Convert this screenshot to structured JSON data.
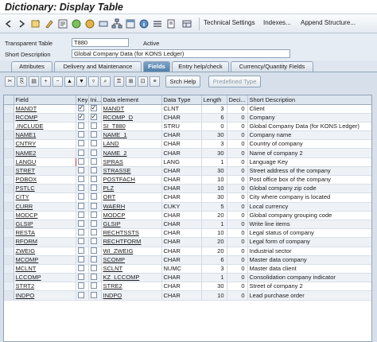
{
  "title": "Dictionary: Display Table",
  "toolbar": {
    "technical_settings": "Technical Settings",
    "indexes": "Indexes...",
    "append_structure": "Append Structure..."
  },
  "header": {
    "table_type_label": "Transparent Table",
    "table_name": "T880",
    "status": "Active",
    "short_desc_label": "Short Description",
    "short_desc": "Global Company Data (for KONS Ledger)"
  },
  "tabs": [
    {
      "label": "Attributes"
    },
    {
      "label": "Delivery and Maintenance"
    },
    {
      "label": "Fields"
    },
    {
      "label": "Entry help/check"
    },
    {
      "label": "Currency/Quantity Fields"
    }
  ],
  "field_toolbar": {
    "srch_help": "Srch Help",
    "predefined_type": "Predefined Type"
  },
  "columns": [
    "Field",
    "Key",
    "Ini...",
    "Data element",
    "Data Type",
    "Length",
    "Deci...",
    "Short Description"
  ],
  "rows": [
    {
      "field": "MANDT",
      "key": true,
      "ini": true,
      "elem": "MANDT",
      "type": "CLNT",
      "len": "3",
      "dec": "0",
      "desc": "Client"
    },
    {
      "field": "RCOMP",
      "key": true,
      "ini": true,
      "elem": "RCOMP_D",
      "type": "CHAR",
      "len": "6",
      "dec": "0",
      "desc": "Company"
    },
    {
      "field": ".INCLUDE",
      "key": false,
      "ini": false,
      "elem": "SI_T880",
      "type": "STRU",
      "len": "0",
      "dec": "0",
      "desc": "Global Company Data (for KONS Ledger)"
    },
    {
      "field": "NAME1",
      "key": false,
      "ini": false,
      "elem": "NAME_1",
      "type": "CHAR",
      "len": "30",
      "dec": "0",
      "desc": "Company name"
    },
    {
      "field": "CNTRY",
      "key": false,
      "ini": false,
      "elem": "LAND",
      "type": "CHAR",
      "len": "3",
      "dec": "0",
      "desc": "Country of company"
    },
    {
      "field": "NAME2",
      "key": false,
      "ini": false,
      "elem": "NAME_2",
      "type": "CHAR",
      "len": "30",
      "dec": "0",
      "desc": "Name of company 2"
    },
    {
      "field": "LANGU",
      "key": false,
      "ini": false,
      "elem": "SPRAS",
      "type": "LANG",
      "len": "1",
      "dec": "0",
      "desc": "Language Key"
    },
    {
      "field": "STRET",
      "key": false,
      "ini": false,
      "elem": "STRASSE",
      "type": "CHAR",
      "len": "30",
      "dec": "0",
      "desc": "Street address of the company"
    },
    {
      "field": "POBOX",
      "key": false,
      "ini": false,
      "elem": "POSTFACH",
      "type": "CHAR",
      "len": "10",
      "dec": "0",
      "desc": "Post office box of the company"
    },
    {
      "field": "PSTLC",
      "key": false,
      "ini": false,
      "elem": "PLZ",
      "type": "CHAR",
      "len": "10",
      "dec": "0",
      "desc": "Global company zip code"
    },
    {
      "field": "CITY",
      "key": false,
      "ini": false,
      "elem": "ORT",
      "type": "CHAR",
      "len": "30",
      "dec": "0",
      "desc": "City where company is located"
    },
    {
      "field": "CURR",
      "key": false,
      "ini": false,
      "elem": "WAERH",
      "type": "CUKY",
      "len": "5",
      "dec": "0",
      "desc": "Local currency"
    },
    {
      "field": "MODCP",
      "key": false,
      "ini": false,
      "elem": "MODCP",
      "type": "CHAR",
      "len": "20",
      "dec": "0",
      "desc": "Global company grouping code"
    },
    {
      "field": "GLSIP",
      "key": false,
      "ini": false,
      "elem": "GLSIP",
      "type": "CHAR",
      "len": "1",
      "dec": "0",
      "desc": "Write line items"
    },
    {
      "field": "RESTA",
      "key": false,
      "ini": false,
      "elem": "RECHTSSTS",
      "type": "CHAR",
      "len": "10",
      "dec": "0",
      "desc": "Legal status of company"
    },
    {
      "field": "RFORM",
      "key": false,
      "ini": false,
      "elem": "RECHTFORM",
      "type": "CHAR",
      "len": "20",
      "dec": "0",
      "desc": "Legal form of company"
    },
    {
      "field": "ZWEIG",
      "key": false,
      "ini": false,
      "elem": "WI_ZWEIG",
      "type": "CHAR",
      "len": "20",
      "dec": "0",
      "desc": "Industrial sector"
    },
    {
      "field": "MCOMP",
      "key": false,
      "ini": false,
      "elem": "SCOMP",
      "type": "CHAR",
      "len": "6",
      "dec": "0",
      "desc": "Master data company"
    },
    {
      "field": "MCLNT",
      "key": false,
      "ini": false,
      "elem": "SCLNT",
      "type": "NUMC",
      "len": "3",
      "dec": "0",
      "desc": "Master data client"
    },
    {
      "field": "LCCOMP",
      "key": false,
      "ini": false,
      "elem": "KZ_LCCOMP",
      "type": "CHAR",
      "len": "1",
      "dec": "0",
      "desc": "Consolidation company indicator"
    },
    {
      "field": "STRT2",
      "key": false,
      "ini": false,
      "elem": "STRE2",
      "type": "CHAR",
      "len": "30",
      "dec": "0",
      "desc": "Street of company 2"
    },
    {
      "field": "INDPO",
      "key": false,
      "ini": false,
      "elem": "INDPO",
      "type": "CHAR",
      "len": "10",
      "dec": "0",
      "desc": "Lead purchase order"
    }
  ],
  "colors": {
    "accent": "#4f7eaa",
    "panel": "#d7e0ea",
    "header_bg": "#dde5ee"
  }
}
